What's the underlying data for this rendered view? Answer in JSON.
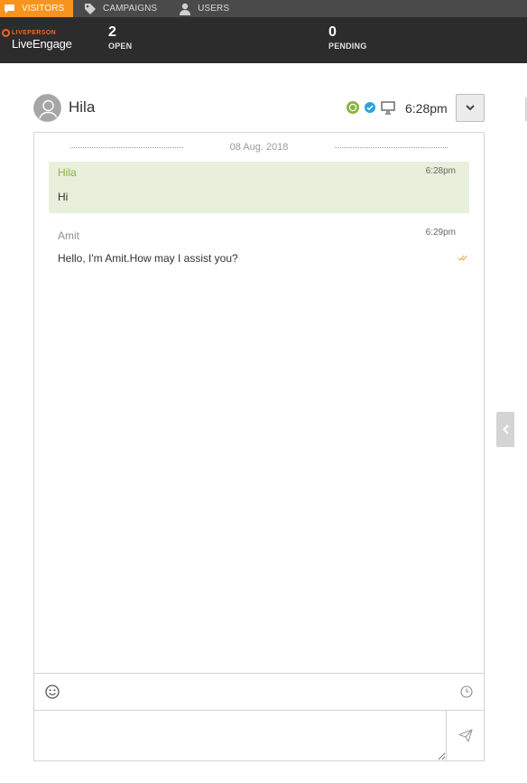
{
  "nav": {
    "tabs": [
      {
        "label": "VISITORS",
        "icon": "chat-bubble-icon",
        "active": true
      },
      {
        "label": "CAMPAIGNS",
        "icon": "tag-icon",
        "active": false
      },
      {
        "label": "USERS",
        "icon": "user-icon",
        "active": false
      }
    ]
  },
  "brand": {
    "top": "LIVEPERSON",
    "name": "LiveEngage"
  },
  "stats": {
    "open": {
      "value": "2",
      "label": "OPEN"
    },
    "pending": {
      "value": "0",
      "label": "PENDING"
    }
  },
  "chat_header": {
    "visitor_name": "Hila",
    "time": "6:28pm",
    "status_icons": [
      "engagement-badge-icon",
      "verified-check-icon",
      "desktop-icon"
    ]
  },
  "transcript": {
    "date": "08 Aug. 2018",
    "messages": [
      {
        "sender": "Hila",
        "time": "6:28pm",
        "text": "Hi",
        "type": "visitor"
      },
      {
        "sender": "Amit",
        "time": "6:29pm",
        "text": "Hello, I'm Amit.How may I assist you?",
        "type": "agent"
      }
    ]
  },
  "compose": {
    "placeholder": ""
  },
  "colors": {
    "accent_orange": "#f7941d",
    "nav_bg": "#4a4a4a",
    "stats_bg": "#2c2c2c",
    "visitor_bubble": "#e8efda",
    "visitor_name": "#8ab43c",
    "check_blue": "#29a3e0"
  }
}
